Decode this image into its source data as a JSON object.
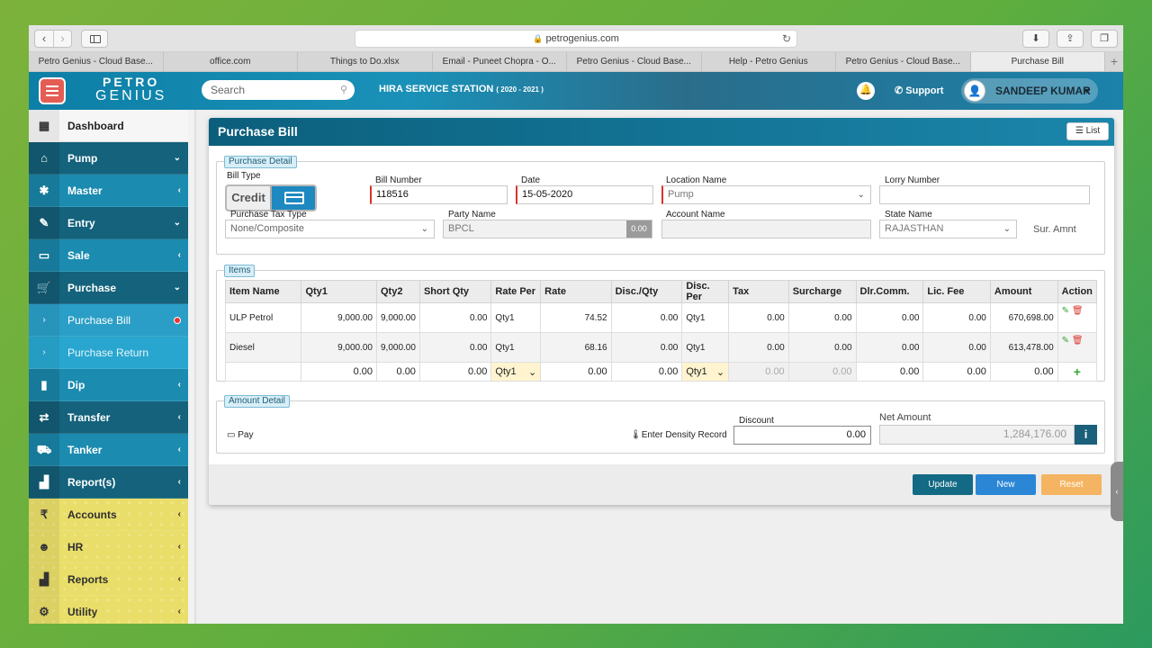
{
  "browser": {
    "url": "petrogenius.com",
    "tabs": [
      "Petro Genius - Cloud Base...",
      "office.com",
      "Things to Do.xlsx",
      "Email - Puneet Chopra - O...",
      "Petro Genius - Cloud Base...",
      "Help - Petro Genius",
      "Petro Genius - Cloud Base...",
      "Purchase Bill"
    ],
    "active_tab": 7
  },
  "header": {
    "brand_line1": "PETRO",
    "brand_line2": "GENIUS",
    "search_placeholder": "Search",
    "station": "HIRA SERVICE STATION",
    "station_year": "( 2020 - 2021 )",
    "support": "Support",
    "user": "SANDEEP KUMAR"
  },
  "sidebar": {
    "items": [
      {
        "label": "Dashboard",
        "icon": "dashboard-icon",
        "style": "dash",
        "chevron": ""
      },
      {
        "label": "Pump",
        "icon": "bank-icon",
        "style": "dk",
        "chevron": "⌄"
      },
      {
        "label": "Master",
        "icon": "asterisk-icon",
        "style": "md",
        "chevron": "‹"
      },
      {
        "label": "Entry",
        "icon": "edit-icon",
        "style": "dk",
        "chevron": "⌄"
      },
      {
        "label": "Sale",
        "icon": "card-icon",
        "style": "md",
        "chevron": "‹"
      },
      {
        "label": "Purchase",
        "icon": "cart-icon",
        "style": "dk",
        "chevron": "⌄"
      },
      {
        "label": "Purchase Bill",
        "icon": "chevron-right-icon",
        "style": "sub sel",
        "chevron": ""
      },
      {
        "label": "Purchase Return",
        "icon": "chevron-right-icon",
        "style": "sub",
        "chevron": ""
      },
      {
        "label": "Dip",
        "icon": "dip-icon",
        "style": "md",
        "chevron": "‹"
      },
      {
        "label": "Transfer",
        "icon": "transfer-icon",
        "style": "dk",
        "chevron": "‹"
      },
      {
        "label": "Tanker",
        "icon": "truck-icon",
        "style": "md",
        "chevron": "‹"
      },
      {
        "label": "Report(s)",
        "icon": "bar-chart-icon",
        "style": "dk",
        "chevron": "‹"
      },
      {
        "label": "Accounts",
        "icon": "rupee-icon",
        "style": "yl",
        "chevron": "‹"
      },
      {
        "label": "HR",
        "icon": "users-icon",
        "style": "yl",
        "chevron": "‹"
      },
      {
        "label": "Reports",
        "icon": "bar-chart-icon",
        "style": "yl",
        "chevron": "‹"
      },
      {
        "label": "Utility",
        "icon": "cogs-icon",
        "style": "yl",
        "chevron": "‹"
      }
    ]
  },
  "page": {
    "title": "Purchase Bill",
    "list_button": "List"
  },
  "purchase_detail": {
    "legend": "Purchase Detail",
    "bill_type_label": "Bill Type",
    "bill_type": "Credit",
    "bill_number_label": "Bill Number",
    "bill_number": "118516",
    "date_label": "Date",
    "date": "15-05-2020",
    "location_label": "Location Name",
    "location": "Pump",
    "lorry_label": "Lorry Number",
    "lorry": "",
    "tax_type_label": "Purchase Tax Type",
    "tax_type": "None/Composite",
    "party_label": "Party Name",
    "party": "BPCL",
    "party_balance": "0.00",
    "account_label": "Account Name",
    "account": "",
    "state_label": "State Name",
    "state": "RAJASTHAN",
    "sur_amnt_label": "Sur. Amnt"
  },
  "items": {
    "legend": "Items",
    "columns": [
      "Item Name",
      "Qty1",
      "Qty2",
      "Short Qty",
      "Rate Per",
      "Rate",
      "Disc./Qty",
      "Disc. Per",
      "Tax",
      "Surcharge",
      "Dlr.Comm.",
      "Lic. Fee",
      "Amount",
      "Action"
    ],
    "rows": [
      [
        "ULP Petrol",
        "9,000.00",
        "9,000.00",
        "0.00",
        "Qty1",
        "74.52",
        "0.00",
        "Qty1",
        "0.00",
        "0.00",
        "0.00",
        "0.00",
        "670,698.00"
      ],
      [
        "Diesel",
        "9,000.00",
        "9,000.00",
        "0.00",
        "Qty1",
        "68.16",
        "0.00",
        "Qty1",
        "0.00",
        "0.00",
        "0.00",
        "0.00",
        "613,478.00"
      ]
    ],
    "entry_row": [
      "",
      "0.00",
      "0.00",
      "0.00",
      "Qty1",
      "0.00",
      "0.00",
      "Qty1",
      "0.00",
      "0.00",
      "0.00",
      "0.00",
      "0.00"
    ]
  },
  "amount_detail": {
    "legend": "Amount Detail",
    "pay": "Pay",
    "density": "Enter Density Record",
    "discount_label": "Discount",
    "discount": "0.00",
    "net_label": "Net Amount",
    "net": "1,284,176.00"
  },
  "actions": {
    "update": "Update",
    "new": "New",
    "reset": "Reset"
  },
  "colors": {
    "update": "#136a84",
    "new": "#2b86d6",
    "reset": "#f5b461"
  }
}
